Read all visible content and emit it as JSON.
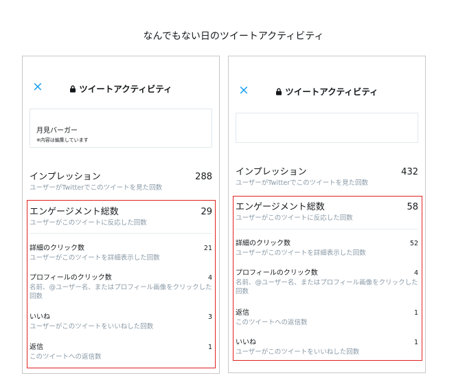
{
  "page_title": "なんでもない日のツイートアクティビティ",
  "colors": {
    "accent": "#1da1f2",
    "highlight": "#e0201e",
    "muted_text": "#8899a6"
  },
  "left": {
    "header": {
      "close_icon": "×",
      "title": "ツイートアクティビティ"
    },
    "tweet": {
      "text": "月見バーガー",
      "note": "※内容は編集しています"
    },
    "impressions": {
      "label": "インプレッション",
      "value": "288",
      "desc": "ユーザーがTwitterでこのツイートを見た回数"
    },
    "engagements": {
      "label": "エンゲージメント総数",
      "value": "29",
      "desc": "ユーザーがこのツイートに反応した回数"
    },
    "detail_clicks": {
      "label": "詳細のクリック数",
      "value": "21",
      "desc": "ユーザーがこのツイートを詳細表示した回数"
    },
    "profile_clicks": {
      "label": "プロフィールのクリック数",
      "value": "4",
      "desc": "名前、@ユーザー名、またはプロフィール画像をクリックした回数"
    },
    "likes": {
      "label": "いいね",
      "value": "3",
      "desc": "ユーザーがこのツイートをいいねした回数"
    },
    "replies": {
      "label": "返信",
      "value": "1",
      "desc": "このツイートへの返信数"
    }
  },
  "right": {
    "header": {
      "close_icon": "×",
      "title": "ツイートアクティビティ"
    },
    "impressions": {
      "label": "インプレッション",
      "value": "432",
      "desc": "ユーザーがTwitterでこのツイートを見た回数"
    },
    "engagements": {
      "label": "エンゲージメント総数",
      "value": "58",
      "desc": "ユーザーがこのツイートに反応した回数"
    },
    "detail_clicks": {
      "label": "詳細のクリック数",
      "value": "52",
      "desc": "ユーザーがこのツイートを詳細表示した回数"
    },
    "profile_clicks": {
      "label": "プロフィールのクリック数",
      "value": "4",
      "desc": "名前、@ユーザー名、またはプロフィール画像をクリックした回数"
    },
    "replies": {
      "label": "返信",
      "value": "1",
      "desc": "このツイートへの返信数"
    },
    "likes": {
      "label": "いいね",
      "value": "1",
      "desc": "ユーザーがこのツイートをいいねした回数"
    }
  }
}
